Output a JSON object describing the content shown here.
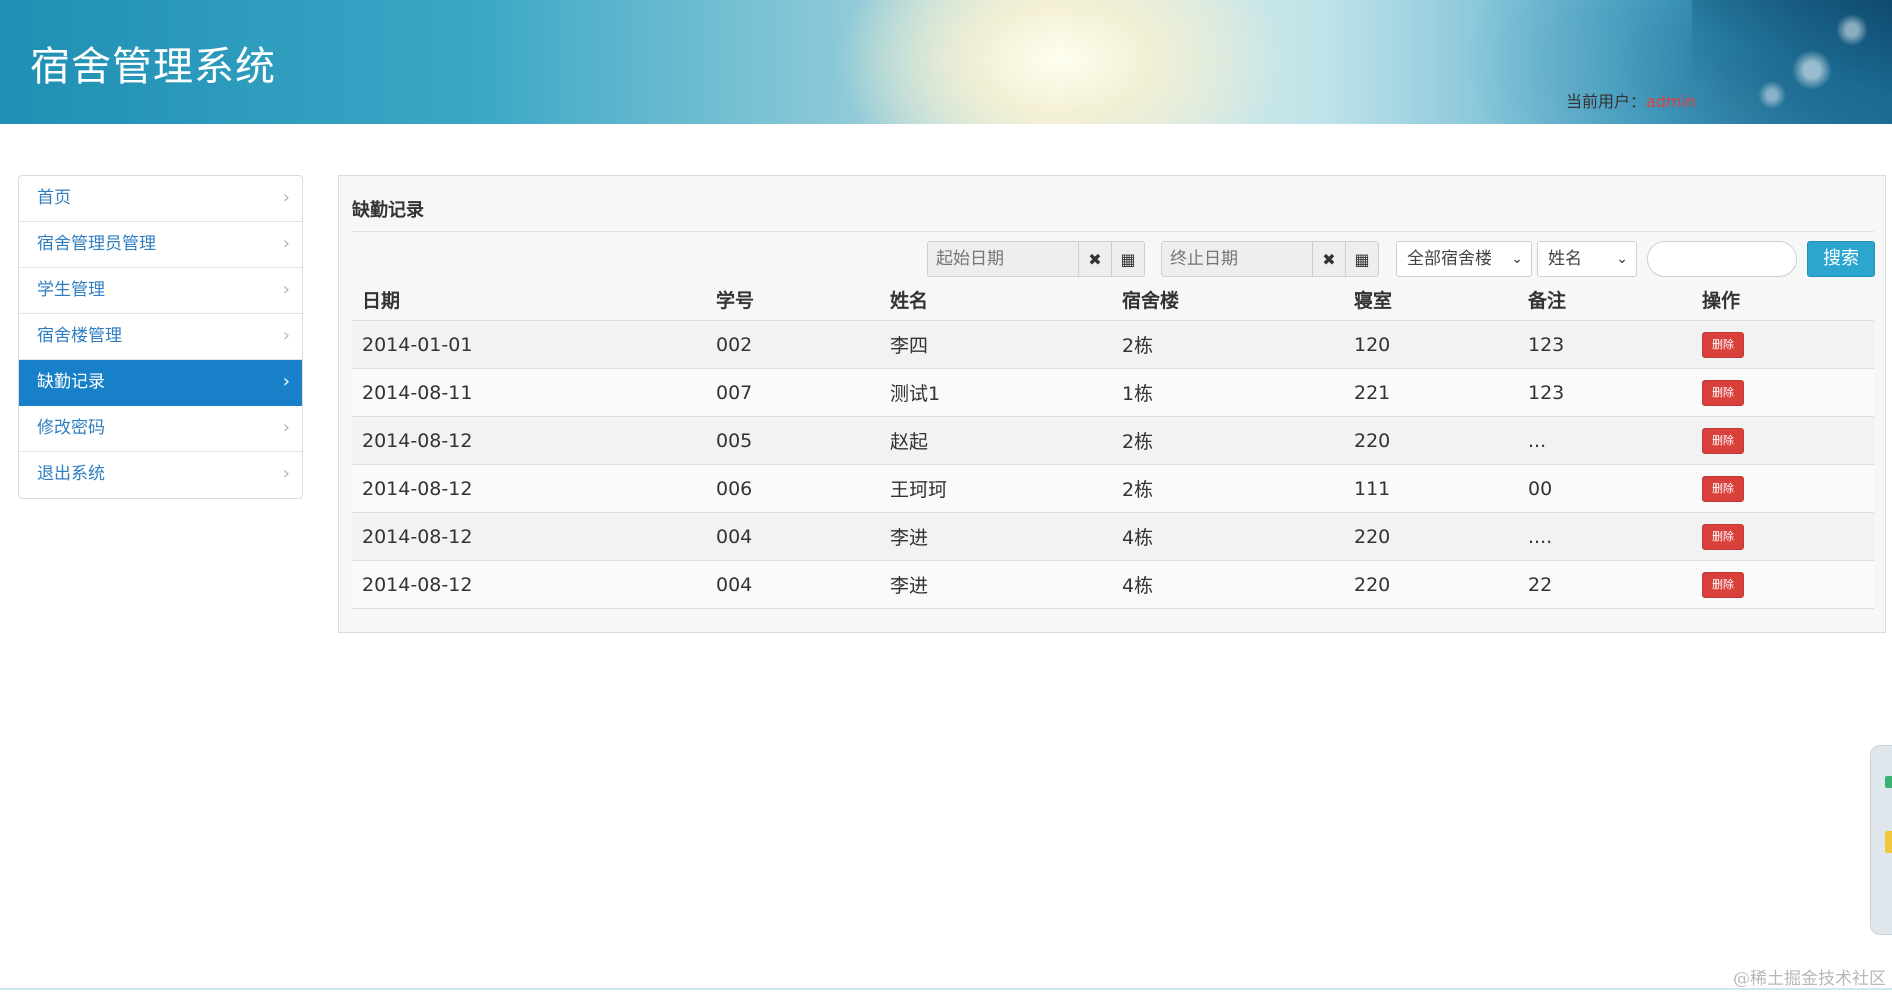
{
  "header": {
    "title": "宿舍管理系统",
    "user_label": "当前用户：",
    "user_name": "admin"
  },
  "sidebar": {
    "items": [
      {
        "label": "首页"
      },
      {
        "label": "宿舍管理员管理"
      },
      {
        "label": "学生管理"
      },
      {
        "label": "宿舍楼管理"
      },
      {
        "label": "缺勤记录",
        "active": true
      },
      {
        "label": "修改密码"
      },
      {
        "label": "退出系统"
      }
    ],
    "chevron_icon": "chevron-right-icon"
  },
  "main": {
    "title": "缺勤记录",
    "toolbar": {
      "start_date_placeholder": "起始日期",
      "end_date_placeholder": "终止日期",
      "clear_icon": "✖",
      "calendar_icon": "▦",
      "building_select": "全部宿舍楼",
      "field_select": "姓名",
      "search_value": "",
      "search_button": "搜索"
    },
    "table": {
      "headers": [
        "日期",
        "学号",
        "姓名",
        "宿舍楼",
        "寝室",
        "备注",
        "操作"
      ],
      "rows": [
        {
          "date": "2014-01-01",
          "no": "002",
          "name": "李四",
          "building": "2栋",
          "room": "120",
          "note": "123",
          "action": "删除"
        },
        {
          "date": "2014-08-11",
          "no": "007",
          "name": "测试1",
          "building": "1栋",
          "room": "221",
          "note": "123",
          "action": "删除"
        },
        {
          "date": "2014-08-12",
          "no": "005",
          "name": "赵起",
          "building": "2栋",
          "room": "220",
          "note": "...",
          "action": "删除"
        },
        {
          "date": "2014-08-12",
          "no": "006",
          "name": "王珂珂",
          "building": "2栋",
          "room": "111",
          "note": "00",
          "action": "删除"
        },
        {
          "date": "2014-08-12",
          "no": "004",
          "name": "李进",
          "building": "4栋",
          "room": "220",
          "note": "....",
          "action": "删除"
        },
        {
          "date": "2014-08-12",
          "no": "004",
          "name": "李进",
          "building": "4栋",
          "room": "220",
          "note": "22",
          "action": "删除"
        }
      ]
    }
  },
  "watermark": "@稀土掘金技术社区",
  "colors": {
    "accent": "#1780c9",
    "link": "#2f7ec2",
    "danger": "#d9403c",
    "search": "#2ca6cf",
    "user_name": "#e83c3c"
  }
}
